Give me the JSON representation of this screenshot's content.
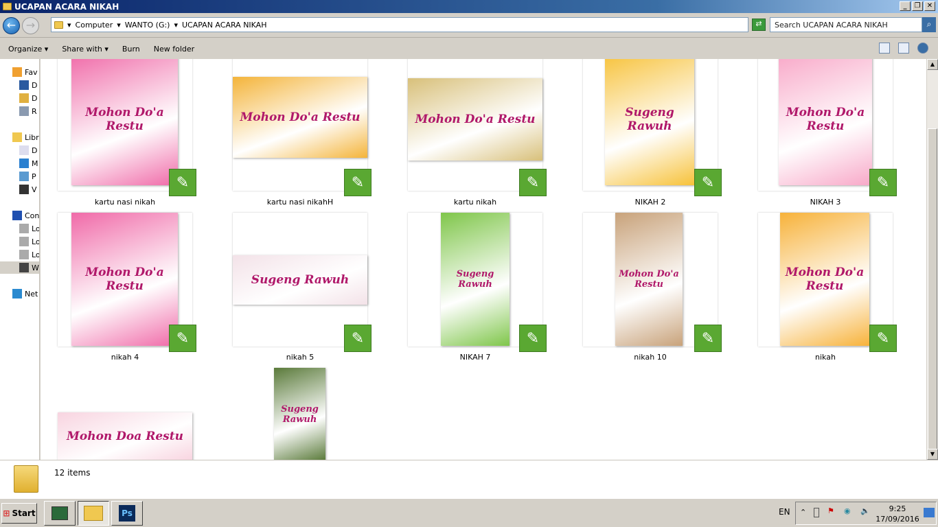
{
  "window": {
    "title": "UCAPAN ACARA NIKAH"
  },
  "address": {
    "crumbs": [
      "Computer",
      "WANTO (G:)",
      "UCAPAN ACARA NIKAH"
    ],
    "search_placeholder": "Search UCAPAN ACARA NIKAH"
  },
  "toolbar": {
    "organize": "Organize",
    "share": "Share with",
    "burn": "Burn",
    "new_folder": "New folder"
  },
  "sidebar": {
    "items": [
      {
        "label": "Fav",
        "icon": "star-icon"
      },
      {
        "label": "D",
        "icon": "desktop-icon"
      },
      {
        "label": "D",
        "icon": "downloads-icon"
      },
      {
        "label": "R",
        "icon": "recent-places-icon"
      },
      {
        "label": "Libr",
        "icon": "libraries-icon"
      },
      {
        "label": "D",
        "icon": "documents-icon"
      },
      {
        "label": "M",
        "icon": "music-icon"
      },
      {
        "label": "P",
        "icon": "pictures-icon"
      },
      {
        "label": "V",
        "icon": "videos-icon"
      },
      {
        "label": "Con",
        "icon": "computer-icon"
      },
      {
        "label": "Lo",
        "icon": "local-disk-icon"
      },
      {
        "label": "Lo",
        "icon": "local-disk-icon"
      },
      {
        "label": "Lo",
        "icon": "local-disk-icon"
      },
      {
        "label": "W",
        "icon": "removable-drive-icon"
      },
      {
        "label": "Net",
        "icon": "network-icon"
      }
    ]
  },
  "files": [
    {
      "name": "kartu nasi nikah",
      "thumb_text": "Mohon Do'a Restu",
      "bg": "#f06aa8"
    },
    {
      "name": "kartu nasi nikahH",
      "thumb_text": "Mohon Do'a Restu",
      "bg": "#f4b43a"
    },
    {
      "name": "kartu nikah",
      "thumb_text": "Mohon Do'a Restu",
      "bg": "#d8c07a"
    },
    {
      "name": "NIKAH 2",
      "thumb_text": "Sugeng Rawuh",
      "bg": "#f7c23a"
    },
    {
      "name": "NIKAH 3",
      "thumb_text": "Mohon Do'a Restu",
      "bg": "#f8a8c8"
    },
    {
      "name": "nikah 4",
      "thumb_text": "Mohon Do'a Restu",
      "bg": "#f06aa8"
    },
    {
      "name": "nikah 5",
      "thumb_text": "Sugeng Rawuh",
      "bg": "#f3e2e8"
    },
    {
      "name": "NIKAH 7",
      "thumb_text": "Sugeng Rawuh",
      "bg": "#7fc64a"
    },
    {
      "name": "nikah 10",
      "thumb_text": "Mohon Do'a Restu",
      "bg": "#c8a27a"
    },
    {
      "name": "nikah",
      "thumb_text": "Mohon Do'a Restu",
      "bg": "#f7b23a"
    },
    {
      "name": "",
      "thumb_text": "Mohon Doa Restu",
      "bg": "#f8d4e0"
    },
    {
      "name": "",
      "thumb_text": "Sugeng Rawuh",
      "bg": "#5a7a3a"
    }
  ],
  "status": {
    "count": "12 items"
  },
  "taskbar": {
    "start": "Start",
    "ps": "Ps",
    "lang": "EN",
    "time": "9:25",
    "date": "17/09/2016"
  }
}
